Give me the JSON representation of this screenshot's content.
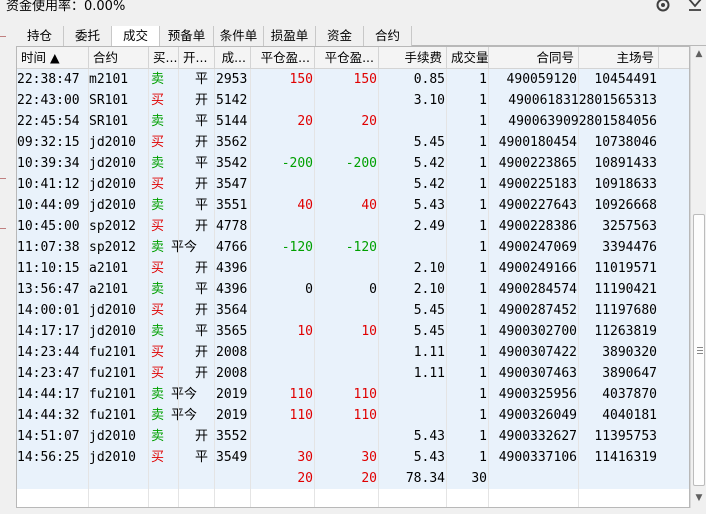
{
  "topbar": {
    "usage_text": "资金使用率：0.00%"
  },
  "tabs": [
    {
      "label": "持仓",
      "active": false
    },
    {
      "label": "委托",
      "active": false
    },
    {
      "label": "成交",
      "active": true
    },
    {
      "label": "预备单",
      "active": false
    },
    {
      "label": "条件单",
      "active": false
    },
    {
      "label": "损盈单",
      "active": false
    },
    {
      "label": "资金",
      "active": false
    },
    {
      "label": "合约",
      "active": false
    }
  ],
  "columns": [
    "时间 ▲",
    "合约",
    "买...",
    "开...",
    "成...",
    "平仓盈...",
    "平仓盈...",
    "手续费",
    "成交量",
    "合同号",
    "主场号"
  ],
  "colors": {
    "buy": "#e00000",
    "sell": "#00a000",
    "profit": "#e00000",
    "loss": "#00a000",
    "row_bg": "#e9f2fb"
  },
  "rows": [
    {
      "time": "22:38:47",
      "contract": "m2101",
      "side": "卖",
      "offset": "平",
      "price": "2953",
      "pl1": "150",
      "pl2": "150",
      "fee": "0.85",
      "qty": "1",
      "order_no": "490059120",
      "exch_no": "10454491"
    },
    {
      "time": "22:43:00",
      "contract": "SR101",
      "side": "买",
      "offset": "开",
      "price": "5142",
      "pl1": "",
      "pl2": "",
      "fee": "3.10",
      "qty": "1",
      "order_no": "4900618312801565313",
      "exch_no": ""
    },
    {
      "time": "22:45:54",
      "contract": "SR101",
      "side": "卖",
      "offset": "平",
      "price": "5144",
      "pl1": "20",
      "pl2": "20",
      "fee": "",
      "qty": "1",
      "order_no": "4900639092801584056",
      "exch_no": ""
    },
    {
      "time": "09:32:15",
      "contract": "jd2010",
      "side": "买",
      "offset": "开",
      "price": "3562",
      "pl1": "",
      "pl2": "",
      "fee": "5.45",
      "qty": "1",
      "order_no": "4900180454",
      "exch_no": "10738046"
    },
    {
      "time": "10:39:34",
      "contract": "jd2010",
      "side": "卖",
      "offset": "平",
      "price": "3542",
      "pl1": "-200",
      "pl2": "-200",
      "fee": "5.42",
      "qty": "1",
      "order_no": "4900223865",
      "exch_no": "10891433"
    },
    {
      "time": "10:41:12",
      "contract": "jd2010",
      "side": "买",
      "offset": "开",
      "price": "3547",
      "pl1": "",
      "pl2": "",
      "fee": "5.42",
      "qty": "1",
      "order_no": "4900225183",
      "exch_no": "10918633"
    },
    {
      "time": "10:44:09",
      "contract": "jd2010",
      "side": "卖",
      "offset": "平",
      "price": "3551",
      "pl1": "40",
      "pl2": "40",
      "fee": "5.43",
      "qty": "1",
      "order_no": "4900227643",
      "exch_no": "10926668"
    },
    {
      "time": "10:45:00",
      "contract": "sp2012",
      "side": "买",
      "offset": "开",
      "price": "4778",
      "pl1": "",
      "pl2": "",
      "fee": "2.49",
      "qty": "1",
      "order_no": "4900228386",
      "exch_no": "3257563"
    },
    {
      "time": "11:07:38",
      "contract": "sp2012",
      "side": "卖",
      "offset": "平今",
      "price": "4766",
      "pl1": "-120",
      "pl2": "-120",
      "fee": "",
      "qty": "1",
      "order_no": "4900247069",
      "exch_no": "3394476"
    },
    {
      "time": "11:10:15",
      "contract": "a2101",
      "side": "买",
      "offset": "开",
      "price": "4396",
      "pl1": "",
      "pl2": "",
      "fee": "2.10",
      "qty": "1",
      "order_no": "4900249166",
      "exch_no": "11019571"
    },
    {
      "time": "13:56:47",
      "contract": "a2101",
      "side": "卖",
      "offset": "平",
      "price": "4396",
      "pl1": "0",
      "pl2": "0",
      "fee": "2.10",
      "qty": "1",
      "order_no": "4900284574",
      "exch_no": "11190421"
    },
    {
      "time": "14:00:01",
      "contract": "jd2010",
      "side": "买",
      "offset": "开",
      "price": "3564",
      "pl1": "",
      "pl2": "",
      "fee": "5.45",
      "qty": "1",
      "order_no": "4900287452",
      "exch_no": "11197680"
    },
    {
      "time": "14:17:17",
      "contract": "jd2010",
      "side": "卖",
      "offset": "平",
      "price": "3565",
      "pl1": "10",
      "pl2": "10",
      "fee": "5.45",
      "qty": "1",
      "order_no": "4900302700",
      "exch_no": "11263819"
    },
    {
      "time": "14:23:44",
      "contract": "fu2101",
      "side": "买",
      "offset": "开",
      "price": "2008",
      "pl1": "",
      "pl2": "",
      "fee": "1.11",
      "qty": "1",
      "order_no": "4900307422",
      "exch_no": "3890320"
    },
    {
      "time": "14:23:47",
      "contract": "fu2101",
      "side": "买",
      "offset": "开",
      "price": "2008",
      "pl1": "",
      "pl2": "",
      "fee": "1.11",
      "qty": "1",
      "order_no": "4900307463",
      "exch_no": "3890647"
    },
    {
      "time": "14:44:17",
      "contract": "fu2101",
      "side": "卖",
      "offset": "平今",
      "price": "2019",
      "pl1": "110",
      "pl2": "110",
      "fee": "",
      "qty": "1",
      "order_no": "4900325956",
      "exch_no": "4037870"
    },
    {
      "time": "14:44:32",
      "contract": "fu2101",
      "side": "卖",
      "offset": "平今",
      "price": "2019",
      "pl1": "110",
      "pl2": "110",
      "fee": "",
      "qty": "1",
      "order_no": "4900326049",
      "exch_no": "4040181"
    },
    {
      "time": "14:51:07",
      "contract": "jd2010",
      "side": "卖",
      "offset": "开",
      "price": "3552",
      "pl1": "",
      "pl2": "",
      "fee": "5.43",
      "qty": "1",
      "order_no": "4900332627",
      "exch_no": "11395753"
    },
    {
      "time": "14:56:25",
      "contract": "jd2010",
      "side": "买",
      "offset": "平",
      "price": "3549",
      "pl1": "30",
      "pl2": "30",
      "fee": "5.43",
      "qty": "1",
      "order_no": "4900337106",
      "exch_no": "11416319"
    }
  ],
  "totals": {
    "pl1": "20",
    "pl2": "20",
    "fee": "78.34",
    "qty": "30"
  }
}
